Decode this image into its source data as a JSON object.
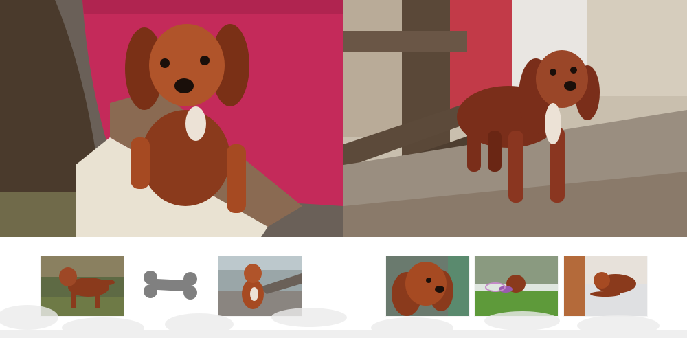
{
  "hero": {
    "left_photo": {
      "subject": "cavalier-king-charles-spaniel-on-wooden-step",
      "accent_color": "#c42a5a"
    },
    "right_photo": {
      "subject": "cavalier-king-charles-spaniel-standing-by-fence",
      "accent_color": "#b83a48"
    }
  },
  "gallery": {
    "thumbnails": [
      {
        "subject": "spaniel-standing-in-garden"
      },
      {
        "subject": "bone-icon"
      },
      {
        "subject": "spaniel-sitting-on-rocks"
      },
      {
        "subject": "spaniel-closeup-portrait"
      },
      {
        "subject": "puppy-on-grass-with-toy"
      },
      {
        "subject": "puppy-lying-on-sofa"
      }
    ]
  },
  "colors": {
    "background": "#ffffff",
    "fur": "#8a3a1c",
    "fur_light": "#b65a2e",
    "bone": "#808080",
    "wash": "#ececec"
  }
}
